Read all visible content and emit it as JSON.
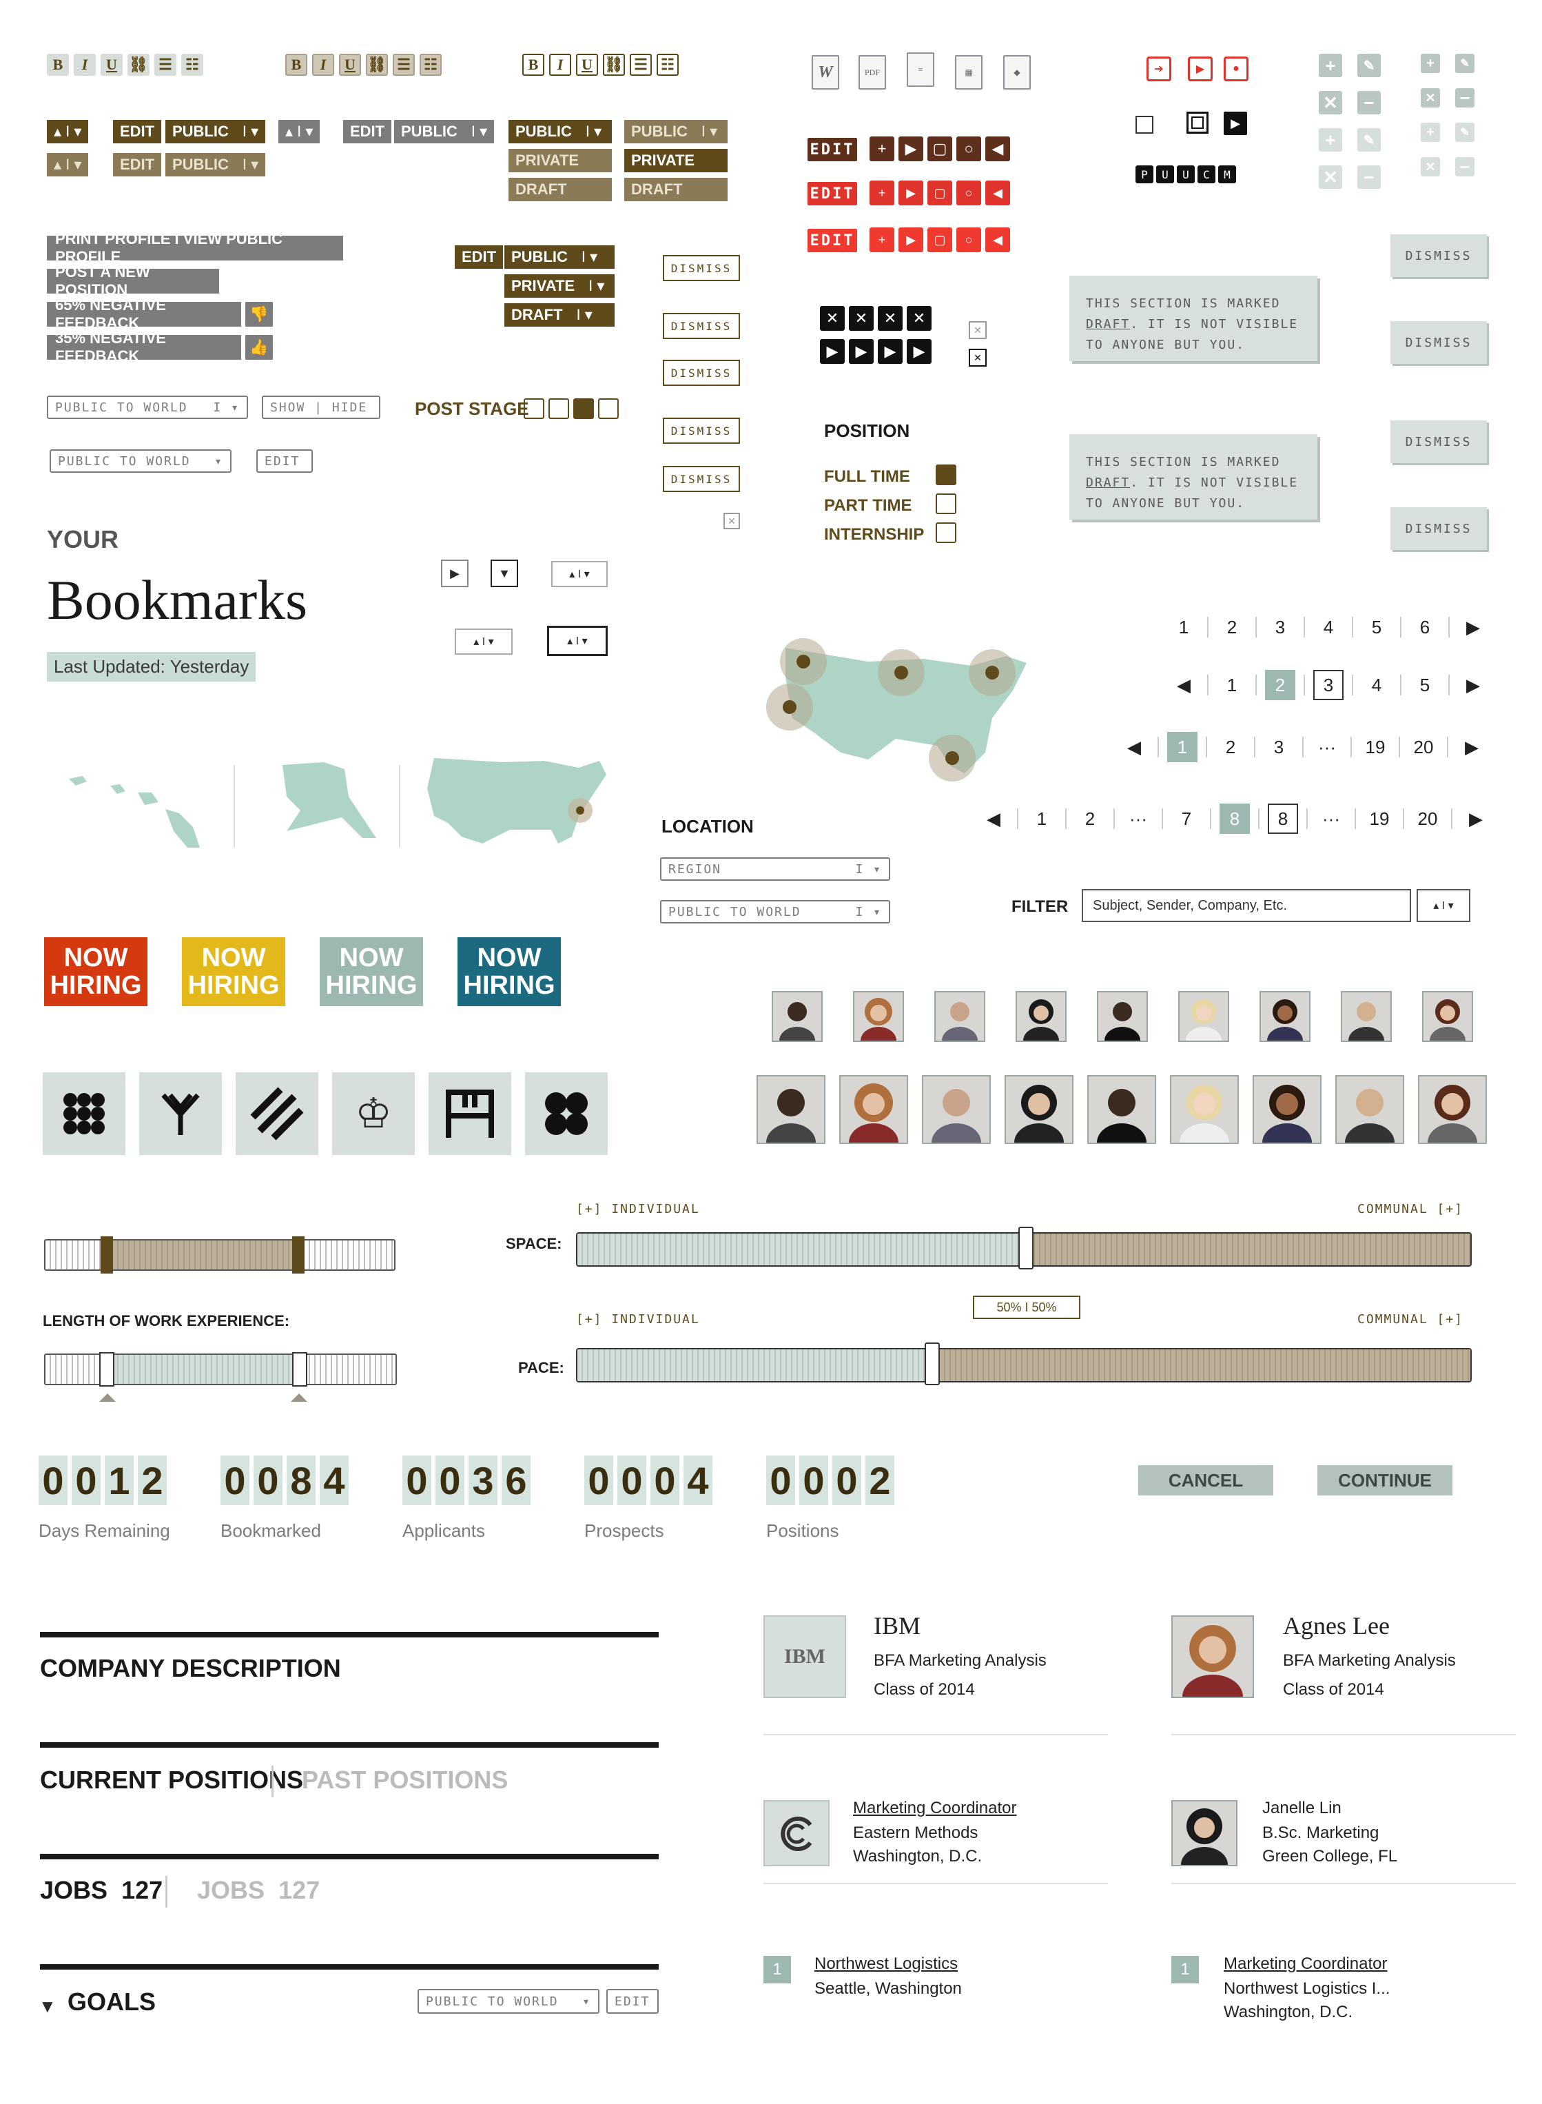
{
  "toolbar": {
    "bold": "B",
    "italic": "I",
    "underline": "U"
  },
  "docs": {
    "word": "W",
    "pdf": "PDF"
  },
  "pills": {
    "edit": "EDIT",
    "public": "PUBLIC",
    "private": "PRIVATE",
    "draft": "DRAFT",
    "pipe": "I",
    "arrow": "▾",
    "updown": "▴"
  },
  "actions": {
    "print_profile": "PRINT PROFILE  I  VIEW PUBLIC PROFILE",
    "post_position": "POST A NEW POSITION",
    "neg_feedback": "65% NEGATIVE FEEDBACK",
    "pos_feedback": "35% NEGATIVE FEEDBACK"
  },
  "dropdowns": {
    "public_to_world": "PUBLIC TO WORLD",
    "show_hide": "SHOW  |  HIDE",
    "edit": "EDIT",
    "region": "REGION"
  },
  "post_stage": "POST STAGE",
  "dismiss": "DISMISS",
  "notice": {
    "line1": "THIS SECTION IS MARKED",
    "line2": "DRAFT",
    "line2_rest": ". IT IS NOT VISIBLE",
    "line3": "TO ANYONE BUT YOU."
  },
  "editred": "EDIT",
  "letters": [
    "P",
    "U",
    "U",
    "C",
    "M"
  ],
  "position": {
    "title": "POSITION",
    "options": [
      {
        "label": "FULL TIME",
        "checked": true
      },
      {
        "label": "PART TIME",
        "checked": false
      },
      {
        "label": "INTERNSHIP",
        "checked": false
      }
    ]
  },
  "bookmarks": {
    "your": "YOUR",
    "title": "Bookmarks",
    "updated": "Last Updated: Yesterday"
  },
  "location": {
    "title": "LOCATION"
  },
  "filter": {
    "label": "FILTER",
    "placeholder": "Subject, Sender, Company, Etc."
  },
  "pagination": {
    "row1": [
      "1",
      "2",
      "3",
      "4",
      "5",
      "6"
    ],
    "row2": [
      "1",
      "2",
      "3",
      "4",
      "5"
    ],
    "row3": [
      "1",
      "2",
      "3",
      "···",
      "19",
      "20"
    ],
    "row4": [
      "1",
      "2",
      "···",
      "7",
      "8",
      "8",
      "···",
      "19",
      "20"
    ]
  },
  "hiring": {
    "now": "NOW",
    "hiring": "HIRING",
    "colors": [
      "#d4390f",
      "#e3b81a",
      "#9cb8b0",
      "#1b6a80"
    ]
  },
  "sliders": {
    "individual": "[+] INDIVIDUAL",
    "communal": "COMMUNAL [+]",
    "space": "SPACE:",
    "pace": "PACE:",
    "split": "50%  I  50%",
    "experience": "LENGTH OF WORK EXPERIENCE:"
  },
  "counters": [
    {
      "digits": [
        "0",
        "0",
        "1",
        "2"
      ],
      "label": "Days Remaining"
    },
    {
      "digits": [
        "0",
        "0",
        "8",
        "4"
      ],
      "label": "Bookmarked"
    },
    {
      "digits": [
        "0",
        "0",
        "3",
        "6"
      ],
      "label": "Applicants"
    },
    {
      "digits": [
        "0",
        "0",
        "0",
        "4"
      ],
      "label": "Prospects"
    },
    {
      "digits": [
        "0",
        "0",
        "0",
        "2"
      ],
      "label": "Positions"
    }
  ],
  "buttons": {
    "cancel": "CANCEL",
    "continue": "CONTINUE"
  },
  "sections": {
    "company_description": "COMPANY DESCRIPTION",
    "current_positions": "CURRENT POSITIONS",
    "past_positions": "PAST POSITIONS",
    "jobs": "JOBS",
    "jobs_count": "127",
    "goals": "GOALS"
  },
  "cards": {
    "ibm": {
      "logo": "IBM",
      "title": "IBM",
      "line1": "BFA Marketing Analysis",
      "line2": "Class of 2014"
    },
    "agnes": {
      "title": "Agnes Lee",
      "line1": "BFA Marketing Analysis",
      "line2": "Class of 2014"
    },
    "marketing": {
      "title": "Marketing Coordinator",
      "line1": "Eastern Methods",
      "line2": "Washington, D.C."
    },
    "janelle": {
      "title": "Janelle Lin",
      "line1": "B.Sc. Marketing",
      "line2": "Green College, FL"
    },
    "nw1": {
      "num": "1",
      "title": "Northwest Logistics",
      "line1": "Seattle, Washington"
    },
    "nw2": {
      "num": "1",
      "title": "Marketing Coordinator",
      "line1": "Northwest Logistics I...",
      "line2": "Washington, D.C."
    }
  }
}
